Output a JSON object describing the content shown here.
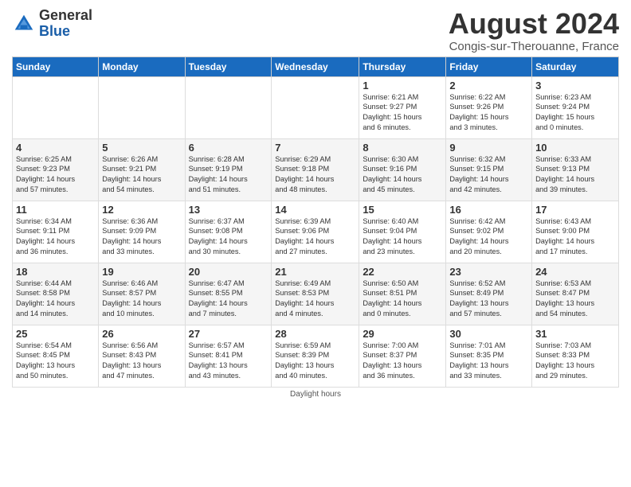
{
  "header": {
    "logo_general": "General",
    "logo_blue": "Blue",
    "month_title": "August 2024",
    "subtitle": "Congis-sur-Therouanne, France"
  },
  "days_of_week": [
    "Sunday",
    "Monday",
    "Tuesday",
    "Wednesday",
    "Thursday",
    "Friday",
    "Saturday"
  ],
  "footer": {
    "note": "Daylight hours"
  },
  "weeks": [
    [
      {
        "day": "",
        "info": ""
      },
      {
        "day": "",
        "info": ""
      },
      {
        "day": "",
        "info": ""
      },
      {
        "day": "",
        "info": ""
      },
      {
        "day": "1",
        "info": "Sunrise: 6:21 AM\nSunset: 9:27 PM\nDaylight: 15 hours\nand 6 minutes."
      },
      {
        "day": "2",
        "info": "Sunrise: 6:22 AM\nSunset: 9:26 PM\nDaylight: 15 hours\nand 3 minutes."
      },
      {
        "day": "3",
        "info": "Sunrise: 6:23 AM\nSunset: 9:24 PM\nDaylight: 15 hours\nand 0 minutes."
      }
    ],
    [
      {
        "day": "4",
        "info": "Sunrise: 6:25 AM\nSunset: 9:23 PM\nDaylight: 14 hours\nand 57 minutes."
      },
      {
        "day": "5",
        "info": "Sunrise: 6:26 AM\nSunset: 9:21 PM\nDaylight: 14 hours\nand 54 minutes."
      },
      {
        "day": "6",
        "info": "Sunrise: 6:28 AM\nSunset: 9:19 PM\nDaylight: 14 hours\nand 51 minutes."
      },
      {
        "day": "7",
        "info": "Sunrise: 6:29 AM\nSunset: 9:18 PM\nDaylight: 14 hours\nand 48 minutes."
      },
      {
        "day": "8",
        "info": "Sunrise: 6:30 AM\nSunset: 9:16 PM\nDaylight: 14 hours\nand 45 minutes."
      },
      {
        "day": "9",
        "info": "Sunrise: 6:32 AM\nSunset: 9:15 PM\nDaylight: 14 hours\nand 42 minutes."
      },
      {
        "day": "10",
        "info": "Sunrise: 6:33 AM\nSunset: 9:13 PM\nDaylight: 14 hours\nand 39 minutes."
      }
    ],
    [
      {
        "day": "11",
        "info": "Sunrise: 6:34 AM\nSunset: 9:11 PM\nDaylight: 14 hours\nand 36 minutes."
      },
      {
        "day": "12",
        "info": "Sunrise: 6:36 AM\nSunset: 9:09 PM\nDaylight: 14 hours\nand 33 minutes."
      },
      {
        "day": "13",
        "info": "Sunrise: 6:37 AM\nSunset: 9:08 PM\nDaylight: 14 hours\nand 30 minutes."
      },
      {
        "day": "14",
        "info": "Sunrise: 6:39 AM\nSunset: 9:06 PM\nDaylight: 14 hours\nand 27 minutes."
      },
      {
        "day": "15",
        "info": "Sunrise: 6:40 AM\nSunset: 9:04 PM\nDaylight: 14 hours\nand 23 minutes."
      },
      {
        "day": "16",
        "info": "Sunrise: 6:42 AM\nSunset: 9:02 PM\nDaylight: 14 hours\nand 20 minutes."
      },
      {
        "day": "17",
        "info": "Sunrise: 6:43 AM\nSunset: 9:00 PM\nDaylight: 14 hours\nand 17 minutes."
      }
    ],
    [
      {
        "day": "18",
        "info": "Sunrise: 6:44 AM\nSunset: 8:58 PM\nDaylight: 14 hours\nand 14 minutes."
      },
      {
        "day": "19",
        "info": "Sunrise: 6:46 AM\nSunset: 8:57 PM\nDaylight: 14 hours\nand 10 minutes."
      },
      {
        "day": "20",
        "info": "Sunrise: 6:47 AM\nSunset: 8:55 PM\nDaylight: 14 hours\nand 7 minutes."
      },
      {
        "day": "21",
        "info": "Sunrise: 6:49 AM\nSunset: 8:53 PM\nDaylight: 14 hours\nand 4 minutes."
      },
      {
        "day": "22",
        "info": "Sunrise: 6:50 AM\nSunset: 8:51 PM\nDaylight: 14 hours\nand 0 minutes."
      },
      {
        "day": "23",
        "info": "Sunrise: 6:52 AM\nSunset: 8:49 PM\nDaylight: 13 hours\nand 57 minutes."
      },
      {
        "day": "24",
        "info": "Sunrise: 6:53 AM\nSunset: 8:47 PM\nDaylight: 13 hours\nand 54 minutes."
      }
    ],
    [
      {
        "day": "25",
        "info": "Sunrise: 6:54 AM\nSunset: 8:45 PM\nDaylight: 13 hours\nand 50 minutes."
      },
      {
        "day": "26",
        "info": "Sunrise: 6:56 AM\nSunset: 8:43 PM\nDaylight: 13 hours\nand 47 minutes."
      },
      {
        "day": "27",
        "info": "Sunrise: 6:57 AM\nSunset: 8:41 PM\nDaylight: 13 hours\nand 43 minutes."
      },
      {
        "day": "28",
        "info": "Sunrise: 6:59 AM\nSunset: 8:39 PM\nDaylight: 13 hours\nand 40 minutes."
      },
      {
        "day": "29",
        "info": "Sunrise: 7:00 AM\nSunset: 8:37 PM\nDaylight: 13 hours\nand 36 minutes."
      },
      {
        "day": "30",
        "info": "Sunrise: 7:01 AM\nSunset: 8:35 PM\nDaylight: 13 hours\nand 33 minutes."
      },
      {
        "day": "31",
        "info": "Sunrise: 7:03 AM\nSunset: 8:33 PM\nDaylight: 13 hours\nand 29 minutes."
      }
    ]
  ]
}
